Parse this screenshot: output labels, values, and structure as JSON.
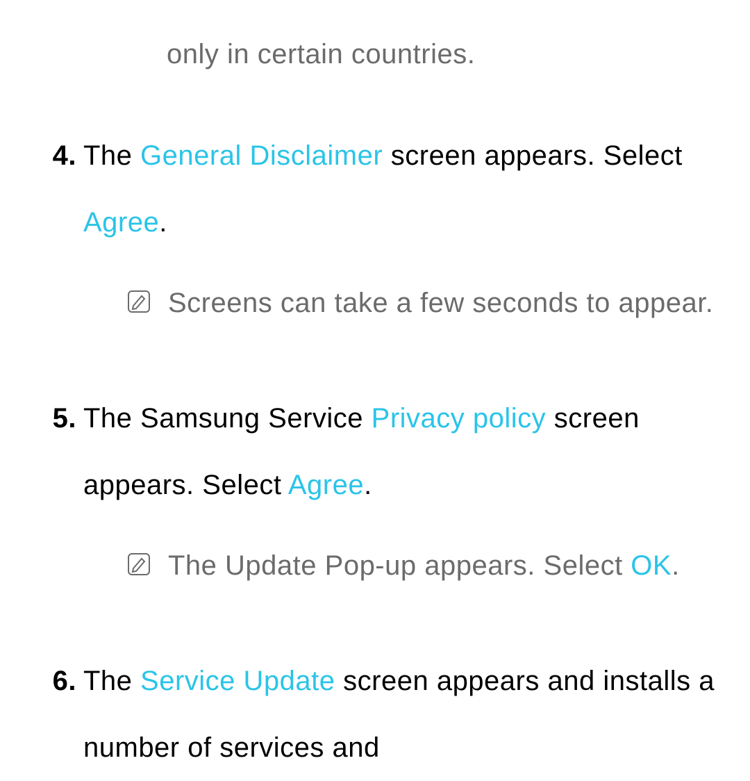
{
  "fragment": "only in certain countries.",
  "steps": {
    "s4": {
      "number": "4.",
      "pre1": "The ",
      "hl1": "General Disclaimer",
      "mid1": " screen appears. Select ",
      "hl2": "Agree",
      "post1": ".",
      "note": "Screens can take a few seconds to appear."
    },
    "s5": {
      "number": "5.",
      "pre1": "The Samsung Service ",
      "hl1": "Privacy policy",
      "mid1": " screen appears. Select ",
      "hl2": "Agree",
      "post1": ".",
      "note_pre": "The Update Pop-up appears. Select ",
      "note_hl": "OK",
      "note_post": "."
    },
    "s6": {
      "number": "6.",
      "pre1": "The ",
      "hl1": "Service Update",
      "post1": " screen appears and installs a number of services and"
    }
  }
}
